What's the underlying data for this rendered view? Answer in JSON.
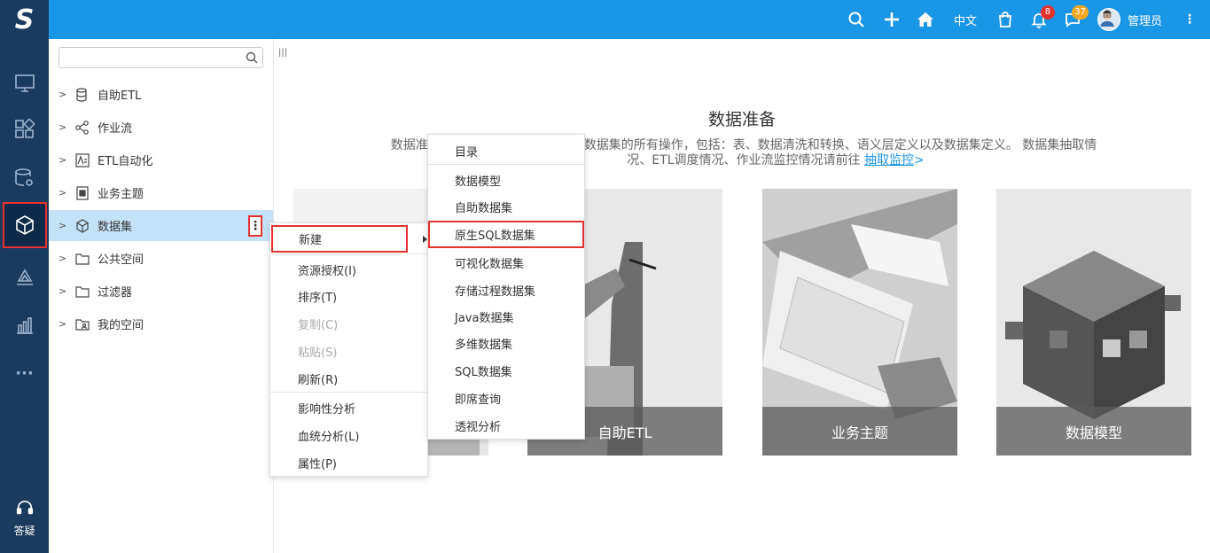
{
  "header": {
    "logo": "S",
    "language": "中文",
    "notification_count": "8",
    "message_count": "37",
    "username": "管理员"
  },
  "rail": {
    "help_label": "答疑"
  },
  "tree": {
    "search_placeholder": "",
    "items": [
      {
        "label": "自助ETL",
        "icon": "database-icon"
      },
      {
        "label": "作业流",
        "icon": "workflow-icon"
      },
      {
        "label": "ETL自动化",
        "icon": "etl-automation-icon"
      },
      {
        "label": "业务主题",
        "icon": "business-topic-icon"
      },
      {
        "label": "数据集",
        "icon": "cube-icon"
      },
      {
        "label": "公共空间",
        "icon": "folder-icon"
      },
      {
        "label": "过滤器",
        "icon": "folder-icon"
      },
      {
        "label": "我的空间",
        "icon": "user-folder-icon"
      }
    ]
  },
  "content": {
    "title": "数据准备",
    "desc_line1_a": "数据准备阶段包",
    "desc_line1_b": "数据集的所有操作，包括：表、数据清洗和转换、语义层定义以及数据集定义。 数据集抽取情",
    "desc_line2": "况、ETL调度情况、作业流监控情况请前往",
    "desc_link": "抽取监控",
    "desc_arrow": ">",
    "cards": [
      {
        "caption": ""
      },
      {
        "caption": "自助ETL"
      },
      {
        "caption": "业务主题"
      },
      {
        "caption": "数据模型"
      }
    ]
  },
  "context_menu": {
    "items": [
      {
        "label": "新建",
        "disabled": false
      },
      {
        "label": "资源授权(I)",
        "disabled": false
      },
      {
        "label": "排序(T)",
        "disabled": false
      },
      {
        "label": "复制(C)",
        "disabled": true
      },
      {
        "label": "粘贴(S)",
        "disabled": true
      },
      {
        "label": "刷新(R)",
        "disabled": false
      },
      {
        "label": "影响性分析",
        "disabled": false
      },
      {
        "label": "血统分析(L)",
        "disabled": false
      },
      {
        "label": "属性(P)",
        "disabled": false
      }
    ]
  },
  "submenu": {
    "items": [
      {
        "label": "目录"
      },
      {
        "label": "数据模型"
      },
      {
        "label": "自助数据集"
      },
      {
        "label": "原生SQL数据集"
      },
      {
        "label": "可视化数据集"
      },
      {
        "label": "存储过程数据集"
      },
      {
        "label": "Java数据集"
      },
      {
        "label": "多维数据集"
      },
      {
        "label": "SQL数据集"
      },
      {
        "label": "即席查询"
      },
      {
        "label": "透视分析"
      }
    ]
  },
  "colors": {
    "header_bg": "#1a96e6",
    "rail_bg": "#1a3a5e",
    "selected_bg": "#c4e2f7",
    "highlight": "#e5322f",
    "link": "#1a96e6"
  }
}
